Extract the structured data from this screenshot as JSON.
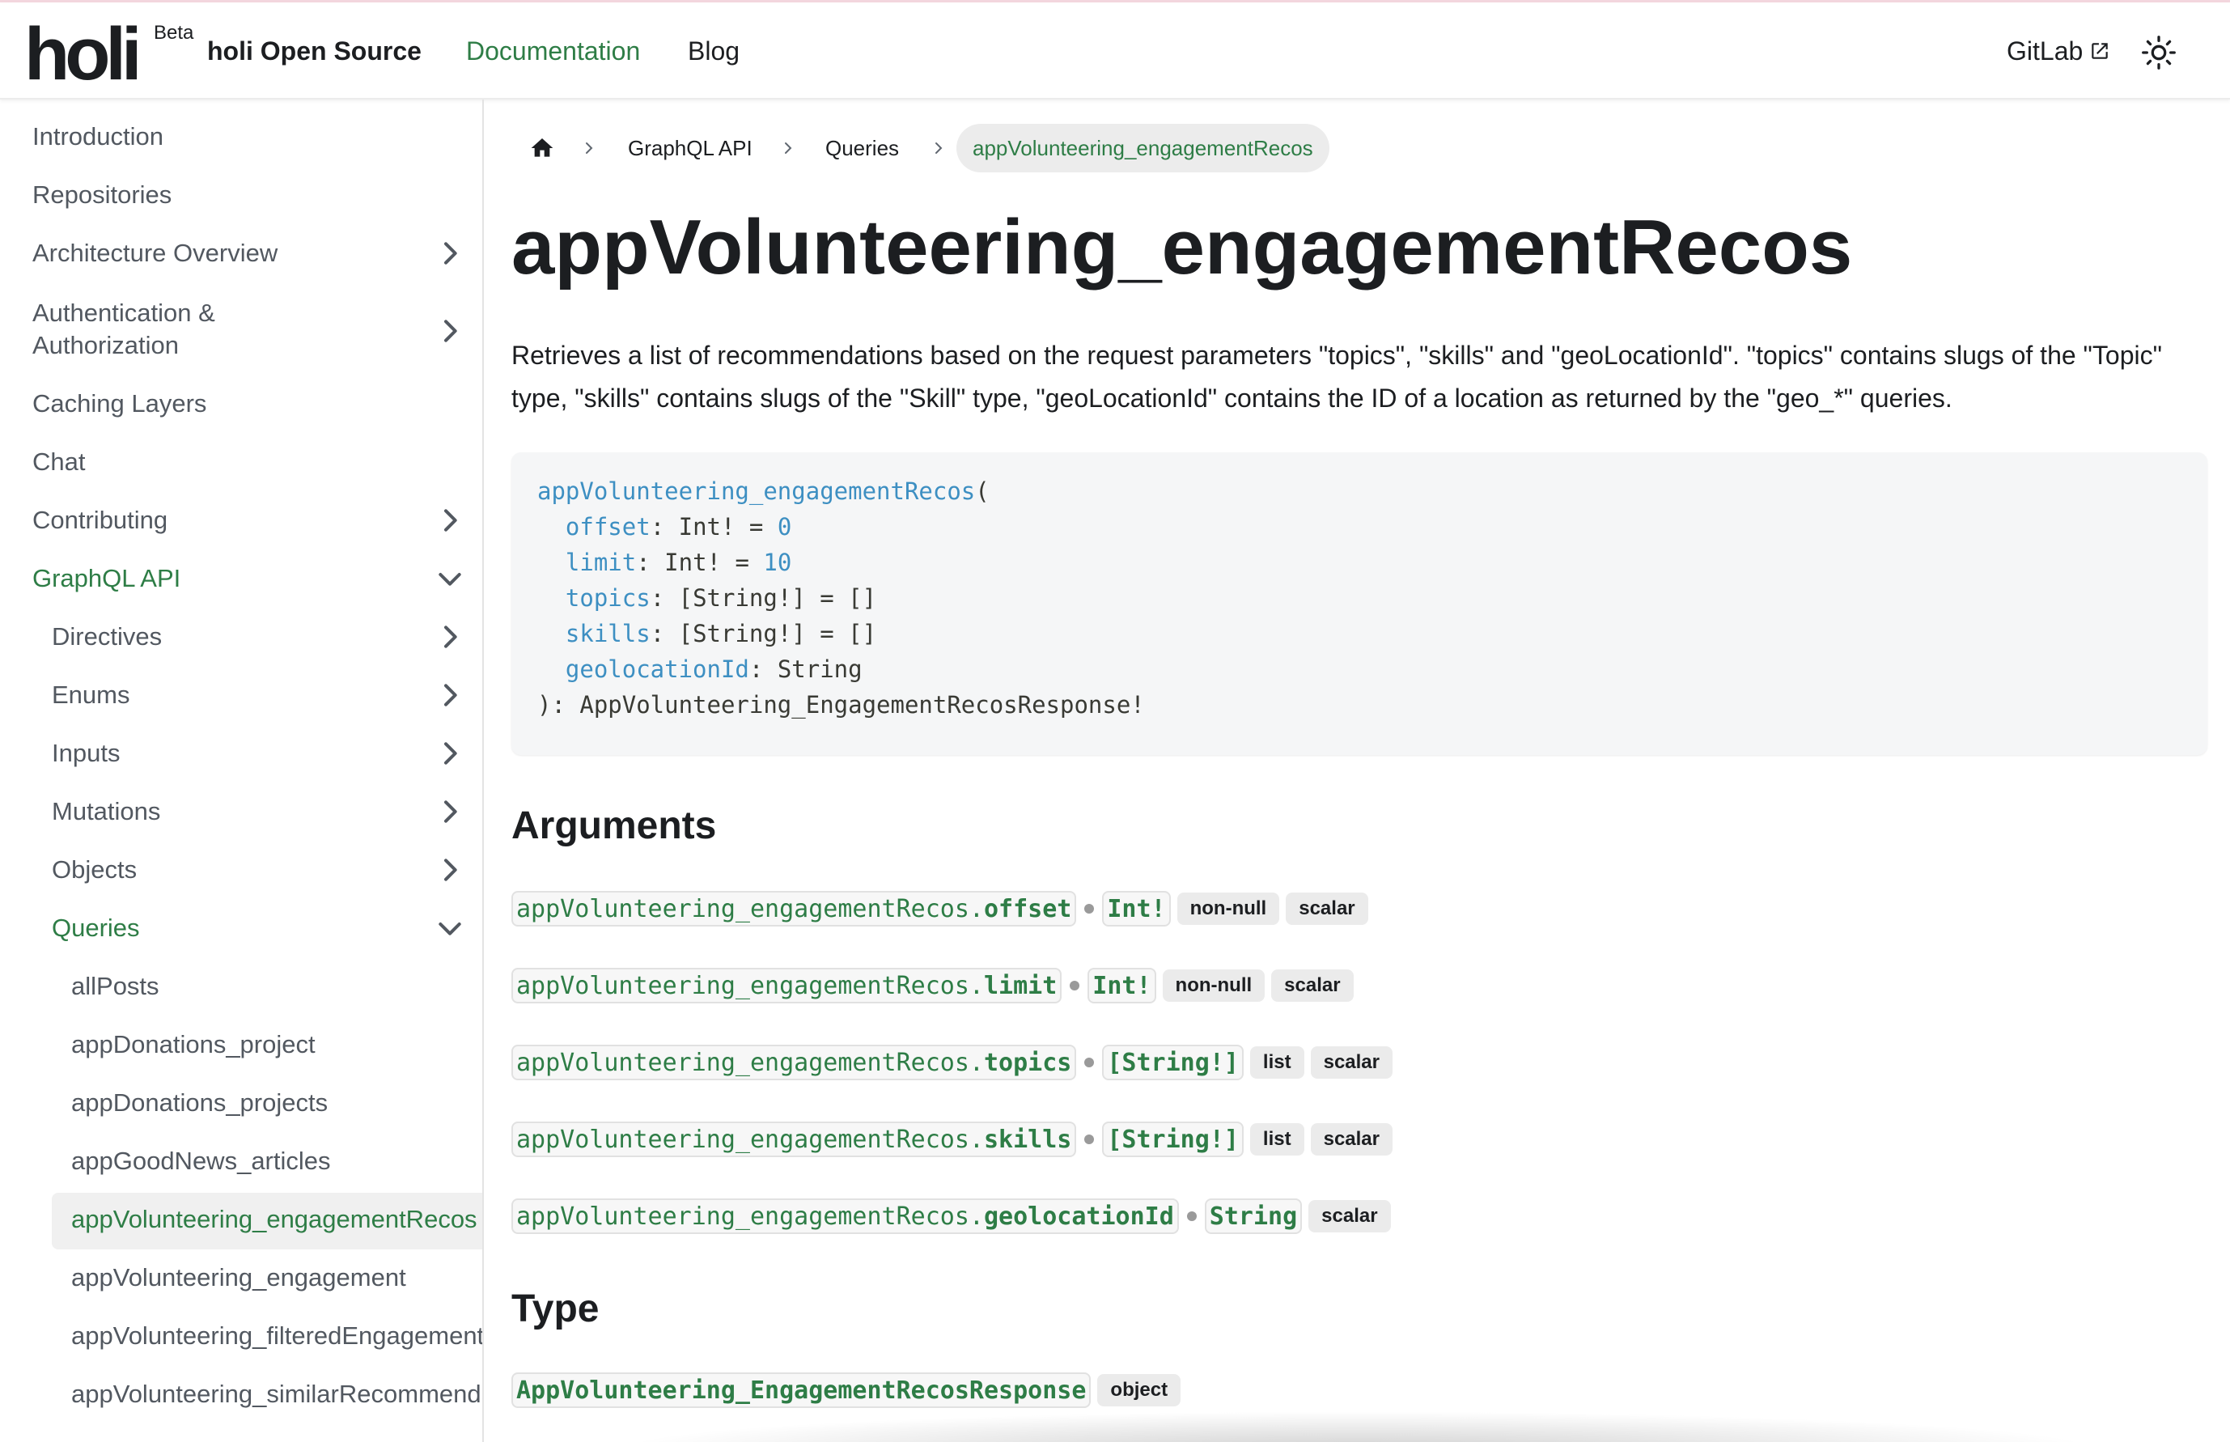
{
  "navbar": {
    "logo": "holi",
    "beta": "Beta",
    "site_title": "holi Open Source",
    "links": {
      "documentation": "Documentation",
      "blog": "Blog",
      "gitlab": "GitLab"
    },
    "accent": "#2e7d46"
  },
  "sidebar": {
    "items": [
      {
        "label": "Introduction"
      },
      {
        "label": "Repositories"
      },
      {
        "label": "Architecture Overview"
      },
      {
        "label": "Authentication &"
      },
      {
        "label": "Authorization"
      },
      {
        "label": "Caching Layers"
      },
      {
        "label": "Chat"
      },
      {
        "label": "Contributing"
      },
      {
        "label": "GraphQL API"
      },
      {
        "label": "Directives"
      },
      {
        "label": "Enums"
      },
      {
        "label": "Inputs"
      },
      {
        "label": "Mutations"
      },
      {
        "label": "Objects"
      },
      {
        "label": "Queries"
      },
      {
        "label": "allPosts"
      },
      {
        "label": "appDonations_project"
      },
      {
        "label": "appDonations_projects"
      },
      {
        "label": "appGoodNews_articles"
      },
      {
        "label": "appVolunteering_engagementRecos"
      },
      {
        "label": "appVolunteering_engagement"
      },
      {
        "label": "appVolunteering_filteredEngagements"
      },
      {
        "label": "appVolunteering_similarRecommendations"
      }
    ]
  },
  "breadcrumb": {
    "items": [
      "GraphQL API",
      "Queries"
    ],
    "current": "appVolunteering_engagementRecos"
  },
  "page": {
    "title": "appVolunteering_engagementRecos",
    "description": "Retrieves a list of recommendations based on the request parameters \"topics\", \"skills\" and \"geoLocationId\". \"topics\" contains slugs of the \"Topic\" type, \"skills\" contains slugs of the \"Skill\" type, \"geoLocationId\" contains the ID of a location as returned by the \"geo_*\" queries."
  },
  "code": {
    "fn": "appVolunteering_engagementRecos",
    "open": "(",
    "args": [
      {
        "name": "offset",
        "type": ": Int! = ",
        "default": "0"
      },
      {
        "name": "limit",
        "type": ": Int! = ",
        "default": "10"
      },
      {
        "name": "topics",
        "type": ": [String!] = []",
        "default": ""
      },
      {
        "name": "skills",
        "type": ": [String!] = []",
        "default": ""
      },
      {
        "name": "geolocationId",
        "type": ": String",
        "default": ""
      }
    ],
    "close": "): AppVolunteering_EngagementRecosResponse!"
  },
  "arguments": {
    "heading": "Arguments",
    "prefix": "appVolunteering_engagementRecos.",
    "items": [
      {
        "name": "offset",
        "type": "Int!",
        "badges": [
          "non-null",
          "scalar"
        ]
      },
      {
        "name": "limit",
        "type": "Int!",
        "badges": [
          "non-null",
          "scalar"
        ]
      },
      {
        "name": "topics",
        "type": "[String!]",
        "badges": [
          "list",
          "scalar"
        ]
      },
      {
        "name": "skills",
        "type": "[String!]",
        "badges": [
          "list",
          "scalar"
        ]
      },
      {
        "name": "geolocationId",
        "type": "String",
        "badges": [
          "scalar"
        ]
      }
    ]
  },
  "type_section": {
    "heading": "Type",
    "name": "AppVolunteering_EngagementRecosResponse",
    "badge": "object"
  }
}
